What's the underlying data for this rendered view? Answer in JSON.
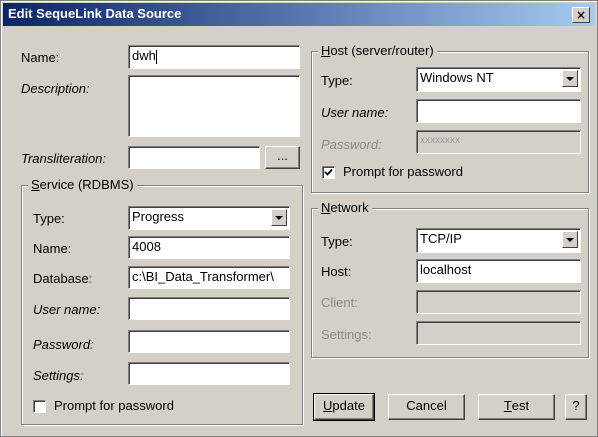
{
  "window": {
    "title": "Edit SequeLink Data Source",
    "close_glyph": "×"
  },
  "general": {
    "name_label": "Name:",
    "name_value": "dwh",
    "description_label": "Description:",
    "description_value": "",
    "transliteration_label": "Transliteration:",
    "transliteration_value": "",
    "browse_label": "..."
  },
  "service": {
    "title_ul": "S",
    "title_rest": "ervice (RDBMS)",
    "type_label": "Type:",
    "type_value": "Progress",
    "name_label": "Name:",
    "name_value": "4008",
    "database_label": "Database:",
    "database_value": "c:\\BI_Data_Transformer\\",
    "username_label": "User name:",
    "username_value": "",
    "password_label": "Password:",
    "password_value": "",
    "settings_label": "Settings:",
    "settings_value": "",
    "prompt_label": "Prompt for password",
    "prompt_checked": false
  },
  "host": {
    "title_ul": "H",
    "title_rest": "ost (server/router)",
    "type_label": "Type:",
    "type_value": "Windows NT",
    "username_label": "User name:",
    "username_value": "",
    "password_label": "Password:",
    "password_value": "xxxxxxxx",
    "prompt_label": "Prompt for password",
    "prompt_checked": true
  },
  "network": {
    "title_ul": "N",
    "title_rest": "etwork",
    "type_label": "Type:",
    "type_value": "TCP/IP",
    "host_label": "Host:",
    "host_value": "localhost",
    "client_label": "Client:",
    "client_value": "",
    "settings_label": "Settings:",
    "settings_value": ""
  },
  "buttons": {
    "update_ul": "U",
    "update_rest": "pdate",
    "cancel": "Cancel",
    "test_ul": "T",
    "test_rest": "est",
    "help": "?"
  }
}
